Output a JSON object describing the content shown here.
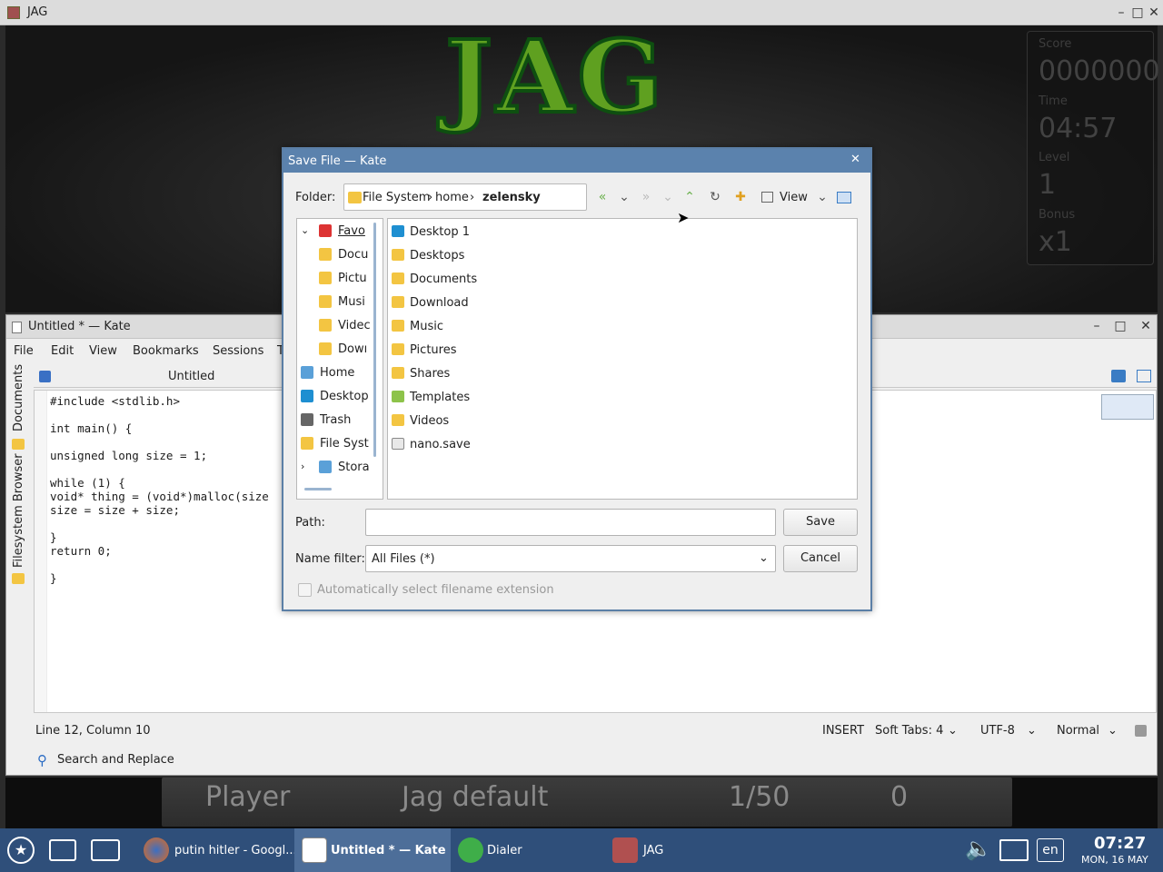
{
  "jag": {
    "title": "JAG",
    "logo": "JAG",
    "score_label": "Score",
    "score_value": "0000000",
    "time_label": "Time",
    "time_value": "04:57",
    "level_label": "Level",
    "level_value": "1",
    "bonus_label": "Bonus",
    "bonus_value": "x1",
    "player": "Player",
    "level_pack": "Jag default",
    "level_progress": "1/50",
    "goals": "0"
  },
  "kate": {
    "title": "Untitled * — Kate",
    "menu": [
      "File",
      "Edit",
      "View",
      "Bookmarks",
      "Sessions",
      "T"
    ],
    "side_tabs": [
      "Documents",
      "Filesystem Browser"
    ],
    "tab_label": "Untitled",
    "code": [
      "#include <stdlib.h>",
      "",
      "int main() {",
      "",
      "unsigned long size = 1;",
      "",
      "while (1) {",
      "void* thing = (void*)malloc(size",
      "size = size + size;",
      "",
      "}",
      "return 0;",
      "",
      "}"
    ],
    "status": {
      "position": "Line 12, Column 10",
      "mode": "INSERT",
      "tabs": "Soft Tabs: 4",
      "encoding": "UTF-8",
      "input_mode": "Normal"
    },
    "search_replace": "Search and Replace"
  },
  "dialog": {
    "title": "Save File — Kate",
    "folder_label": "Folder:",
    "breadcrumb": [
      "File System",
      "home",
      "zelensky"
    ],
    "view_label": "View",
    "places": [
      {
        "label": "Favo",
        "icon": "heart-icon",
        "indent": false,
        "expander": "down"
      },
      {
        "label": "Docu",
        "icon": "document-folder-icon",
        "indent": true
      },
      {
        "label": "Pictu",
        "icon": "picture-folder-icon",
        "indent": true
      },
      {
        "label": "Musi",
        "icon": "music-folder-icon",
        "indent": true
      },
      {
        "label": "Videc",
        "icon": "video-folder-icon",
        "indent": true
      },
      {
        "label": "Dowı",
        "icon": "download-folder-icon",
        "indent": true
      },
      {
        "label": "Home",
        "icon": "home-icon",
        "indent": false
      },
      {
        "label": "Desktop",
        "icon": "desktop-icon",
        "indent": false
      },
      {
        "label": "Trash",
        "icon": "trash-icon",
        "indent": false
      },
      {
        "label": "File Syst",
        "icon": "folder-icon",
        "indent": false
      },
      {
        "label": "Stora",
        "icon": "storage-icon",
        "indent": false,
        "expander": "right"
      }
    ],
    "files": [
      {
        "name": "Desktop 1",
        "icon": "desktop-link-icon"
      },
      {
        "name": "Desktops",
        "icon": "folder-icon"
      },
      {
        "name": "Documents",
        "icon": "document-folder-icon"
      },
      {
        "name": "Download",
        "icon": "download-folder-icon"
      },
      {
        "name": "Music",
        "icon": "music-folder-icon"
      },
      {
        "name": "Pictures",
        "icon": "picture-folder-icon"
      },
      {
        "name": "Shares",
        "icon": "shared-folder-icon"
      },
      {
        "name": "Templates",
        "icon": "templates-folder-icon"
      },
      {
        "name": "Videos",
        "icon": "video-folder-icon"
      },
      {
        "name": "nano.save",
        "icon": "c-file-icon"
      }
    ],
    "path_label": "Path:",
    "path_value": "",
    "save_label": "Save",
    "filter_label": "Name filter:",
    "filter_value": "All Files (*)",
    "cancel_label": "Cancel",
    "auto_ext_label": "Automatically select filename extension"
  },
  "taskbar": {
    "tasks": [
      "putin hitler - Googl...",
      "Untitled * — Kate",
      "Dialer",
      "JAG"
    ],
    "language": "en",
    "time": "07:27",
    "date": "MON, 16 MAY"
  }
}
